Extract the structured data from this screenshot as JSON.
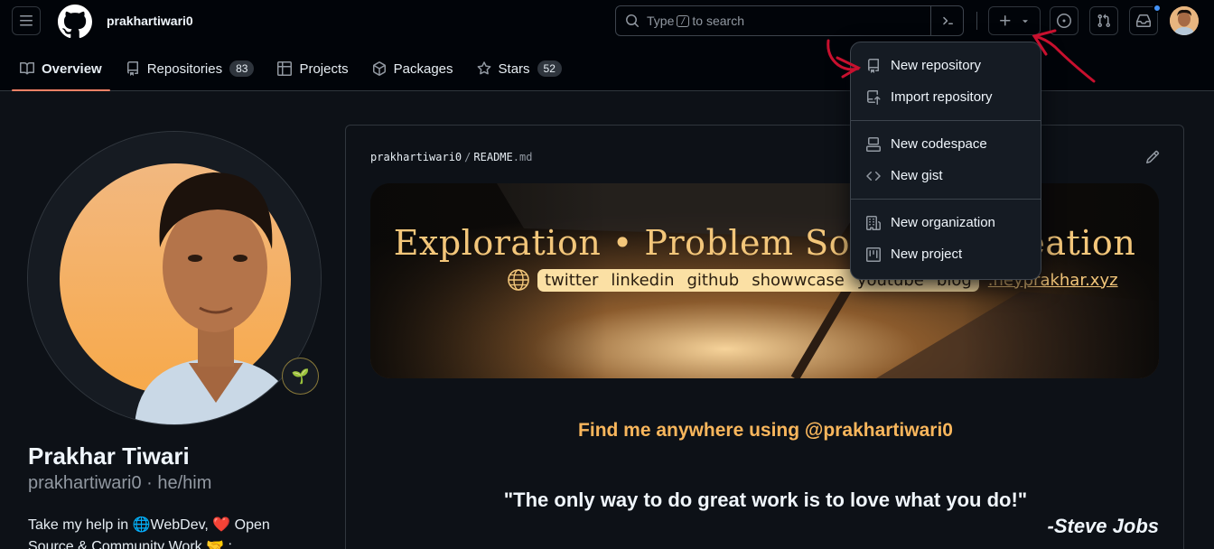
{
  "header": {
    "username": "prakhartiwari0",
    "search": {
      "prefix": "Type",
      "key": "/",
      "suffix": "to search"
    }
  },
  "tabs": [
    {
      "label": "Overview",
      "icon": "book-icon"
    },
    {
      "label": "Repositories",
      "icon": "repo-icon",
      "count": "83"
    },
    {
      "label": "Projects",
      "icon": "table-icon"
    },
    {
      "label": "Packages",
      "icon": "package-icon"
    },
    {
      "label": "Stars",
      "icon": "star-icon",
      "count": "52"
    }
  ],
  "profile": {
    "name": "Prakhar Tiwari",
    "handle": "prakhartiwari0 · he/him",
    "bio": "Take my help in 🌐WebDev, ❤️ Open Source & Community Work 🤝 :",
    "badge": "🌱"
  },
  "readme": {
    "owner": "prakhartiwari0",
    "sep": "/",
    "file": "README",
    "ext": ".md",
    "banner_title": "Exploration • Problem Solving • Creation",
    "banner_links": [
      "twitter",
      "linkedin",
      "github",
      "showwcase",
      "youtube",
      "blog"
    ],
    "banner_site": ".heyprakhar.xyz",
    "find_me": "Find me anywhere using @prakhartiwari0",
    "quote": "\"The only way to do great work is to love what you do!\"",
    "author": "-Steve Jobs"
  },
  "dropdown": {
    "items": [
      {
        "label": "New repository",
        "icon": "repo-icon"
      },
      {
        "label": "Import repository",
        "icon": "repo-push-icon"
      },
      {
        "label": "New codespace",
        "icon": "codespaces-icon"
      },
      {
        "label": "New gist",
        "icon": "code-icon"
      },
      {
        "label": "New organization",
        "icon": "organization-icon"
      },
      {
        "label": "New project",
        "icon": "project-icon"
      }
    ]
  },
  "colors": {
    "background": "#0d1117",
    "header": "#010409",
    "accent_tab": "#f78166",
    "find_text": "#f8b65c",
    "banner_text": "#f3c67a",
    "annotation": "#c8102e",
    "notification_dot": "#4493f8"
  }
}
